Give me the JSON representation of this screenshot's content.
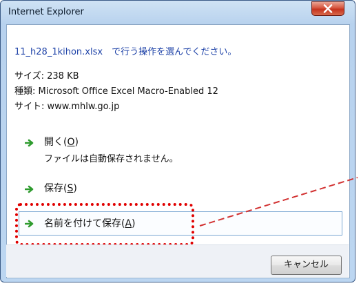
{
  "window": {
    "title": "Internet Explorer"
  },
  "header": {
    "prompt": "11_h28_1kihon.xlsx　で行う操作を選んでください。"
  },
  "file_info": {
    "size": "サイズ: 238 KB",
    "type": "種類: Microsoft Office Excel Macro-Enabled 12",
    "site": "サイト: www.mhlw.go.jp"
  },
  "actions": {
    "open": {
      "label": "開く",
      "key": "O",
      "description": "ファイルは自動保存されません。"
    },
    "save": {
      "label": "保存",
      "key": "S"
    },
    "save_as": {
      "label": "名前を付けて保存",
      "key": "A"
    }
  },
  "footer": {
    "cancel_label": "キャンセル"
  },
  "colors": {
    "accent_link": "#1f43a8",
    "arrow_green": "#2e9b2e",
    "highlight": "#e00000"
  }
}
